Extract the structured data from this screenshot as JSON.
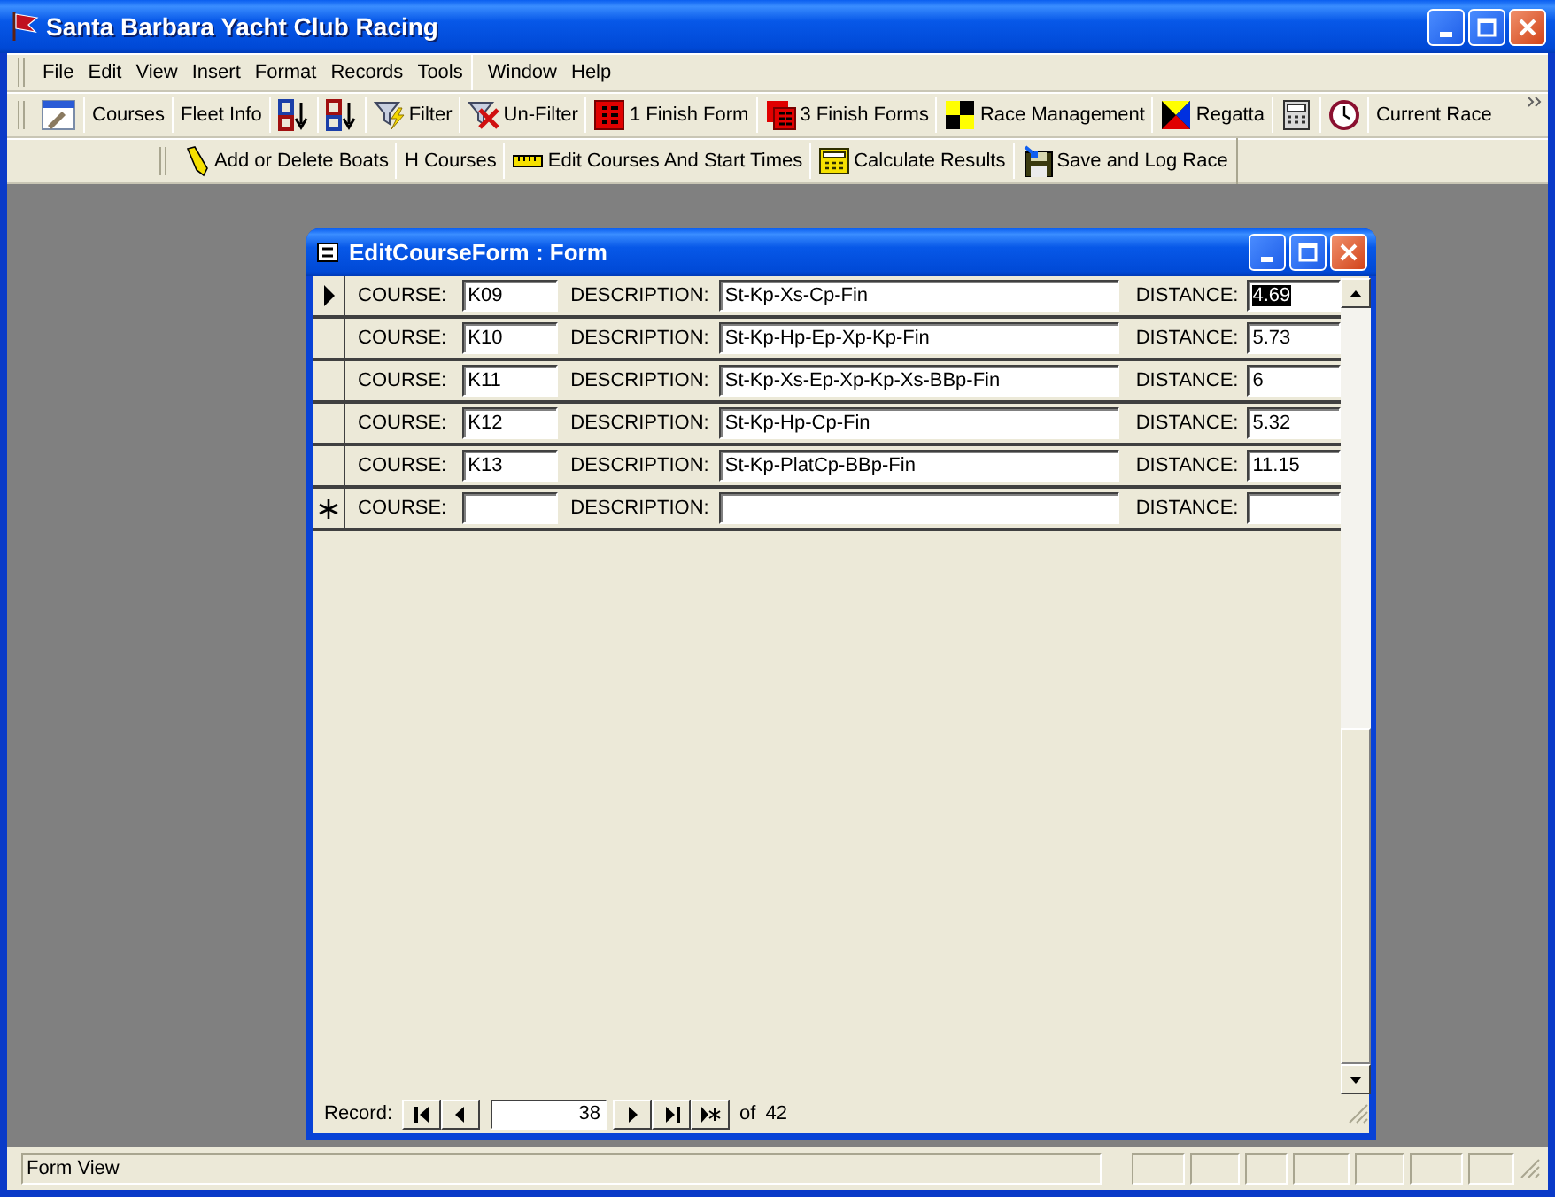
{
  "window": {
    "title": "Santa Barbara Yacht Club Racing"
  },
  "menu": [
    "File",
    "Edit",
    "View",
    "Insert",
    "Format",
    "Records",
    "Tools",
    "Window",
    "Help"
  ],
  "toolbar": [
    {
      "kind": "design"
    },
    {
      "kind": "text",
      "label": "Courses"
    },
    {
      "kind": "text",
      "label": "Fleet Info"
    },
    {
      "kind": "sort-asc"
    },
    {
      "kind": "sort-desc"
    },
    {
      "kind": "filter",
      "label": "Filter"
    },
    {
      "kind": "unfilter",
      "label": "Un-Filter"
    },
    {
      "kind": "finish-form",
      "label": "1 Finish Form"
    },
    {
      "kind": "finish-forms",
      "label": "3 Finish Forms"
    },
    {
      "kind": "checker",
      "label": "Race Management"
    },
    {
      "kind": "flag",
      "label": "Regatta"
    },
    {
      "kind": "calculator"
    },
    {
      "kind": "clock"
    },
    {
      "kind": "text",
      "label": "Current Race"
    }
  ],
  "toolbar_2": [
    {
      "kind": "pencil",
      "label": "Add or Delete Boats"
    },
    {
      "kind": "text",
      "label": "H Courses"
    },
    {
      "kind": "ruler",
      "label": "Edit Courses And Start Times"
    },
    {
      "kind": "calc-yellow",
      "label": "Calculate Results"
    },
    {
      "kind": "floppy",
      "label": "Save and Log Race"
    }
  ],
  "form": {
    "title": "EditCourseForm : Form",
    "records": [
      {
        "kind": "current",
        "course_label": "COURSE:",
        "course": "K09",
        "description_label": "DESCRIPTION:",
        "description": "St-Kp-Xs-Cp-Fin",
        "distance_label": "DISTANCE:",
        "distance": "4.69",
        "distance_selected": true
      },
      {
        "kind": "record",
        "course_label": "COURSE:",
        "course": "K10",
        "description_label": "DESCRIPTION:",
        "description": "St-Kp-Hp-Ep-Xp-Kp-Fin",
        "distance_label": "DISTANCE:",
        "distance": "5.73",
        "distance_selected": false
      },
      {
        "kind": "record",
        "course_label": "COURSE:",
        "course": "K11",
        "description_label": "DESCRIPTION:",
        "description": "St-Kp-Xs-Ep-Xp-Kp-Xs-BBp-Fin",
        "distance_label": "DISTANCE:",
        "distance": "6",
        "distance_selected": false
      },
      {
        "kind": "record",
        "course_label": "COURSE:",
        "course": "K12",
        "description_label": "DESCRIPTION:",
        "description": "St-Kp-Hp-Cp-Fin",
        "distance_label": "DISTANCE:",
        "distance": "5.32",
        "distance_selected": false
      },
      {
        "kind": "record",
        "course_label": "COURSE:",
        "course": "K13",
        "description_label": "DESCRIPTION:",
        "description": "St-Kp-PlatCp-BBp-Fin",
        "distance_label": "DISTANCE:",
        "distance": "11.15",
        "distance_selected": false
      },
      {
        "kind": "new",
        "course_label": "COURSE:",
        "description_label": "DESCRIPTION:",
        "distance_label": "DISTANCE:",
        "distance_selected": false
      }
    ],
    "navigation": {
      "label": "Record:",
      "current": "38",
      "of": "of",
      "total": "42"
    }
  },
  "status_bar": {
    "text": "Form View"
  }
}
